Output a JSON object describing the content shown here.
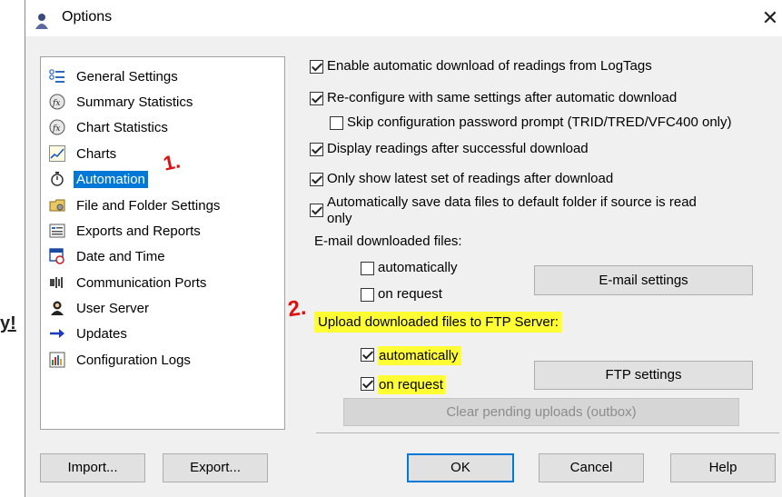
{
  "window": {
    "title": "Options",
    "close_glyph": "✕"
  },
  "side_fragment": "y!",
  "tree": {
    "items": [
      {
        "label": "General Settings",
        "icon": "settings-list-icon"
      },
      {
        "label": "Summary Statistics",
        "icon": "fx-stats-icon"
      },
      {
        "label": "Chart Statistics",
        "icon": "fx-stats-icon"
      },
      {
        "label": "Charts",
        "icon": "line-chart-icon"
      },
      {
        "label": "Automation",
        "icon": "stopwatch-icon",
        "selected": true
      },
      {
        "label": "File and Folder Settings",
        "icon": "folder-settings-icon"
      },
      {
        "label": "Exports and Reports",
        "icon": "report-icon"
      },
      {
        "label": "Date and Time",
        "icon": "calendar-clock-icon"
      },
      {
        "label": "Communication Ports",
        "icon": "port-icon"
      },
      {
        "label": "User Server",
        "icon": "user-server-icon"
      },
      {
        "label": "Updates",
        "icon": "arrow-right-icon"
      },
      {
        "label": "Configuration Logs",
        "icon": "log-icon"
      }
    ]
  },
  "annotations": {
    "one": "1.",
    "two": "2."
  },
  "options": {
    "enable_auto_download": {
      "label": "Enable automatic download of readings from LogTags",
      "checked": true
    },
    "reconfigure": {
      "label": "Re-configure with same settings after automatic download",
      "checked": true
    },
    "skip_password": {
      "label": "Skip configuration password prompt (TRID/TRED/VFC400 only)",
      "checked": false
    },
    "display_readings": {
      "label": "Display readings after successful download",
      "checked": true
    },
    "only_latest": {
      "label": "Only show latest set of readings after download",
      "checked": true
    },
    "auto_save_line1": "Automatically save data files to default folder if source is read",
    "auto_save_line2": "only",
    "auto_save_checked": true
  },
  "email": {
    "heading": "E-mail downloaded files:",
    "automatically": {
      "label": "automatically",
      "checked": false
    },
    "on_request": {
      "label": "on request",
      "checked": false
    },
    "settings_button": "E-mail settings"
  },
  "ftp": {
    "heading": "Upload downloaded files to FTP Server:",
    "automatically": {
      "label": "automatically",
      "checked": true
    },
    "on_request": {
      "label": "on request",
      "checked": true
    },
    "settings_button": "FTP settings",
    "clear_button": "Clear pending uploads (outbox)"
  },
  "footer": {
    "import": "Import...",
    "export": "Export...",
    "ok": "OK",
    "cancel": "Cancel",
    "help": "Help"
  },
  "colors": {
    "selection": "#0078d7",
    "highlight": "#ffff33",
    "annotation": "#dd1111"
  }
}
